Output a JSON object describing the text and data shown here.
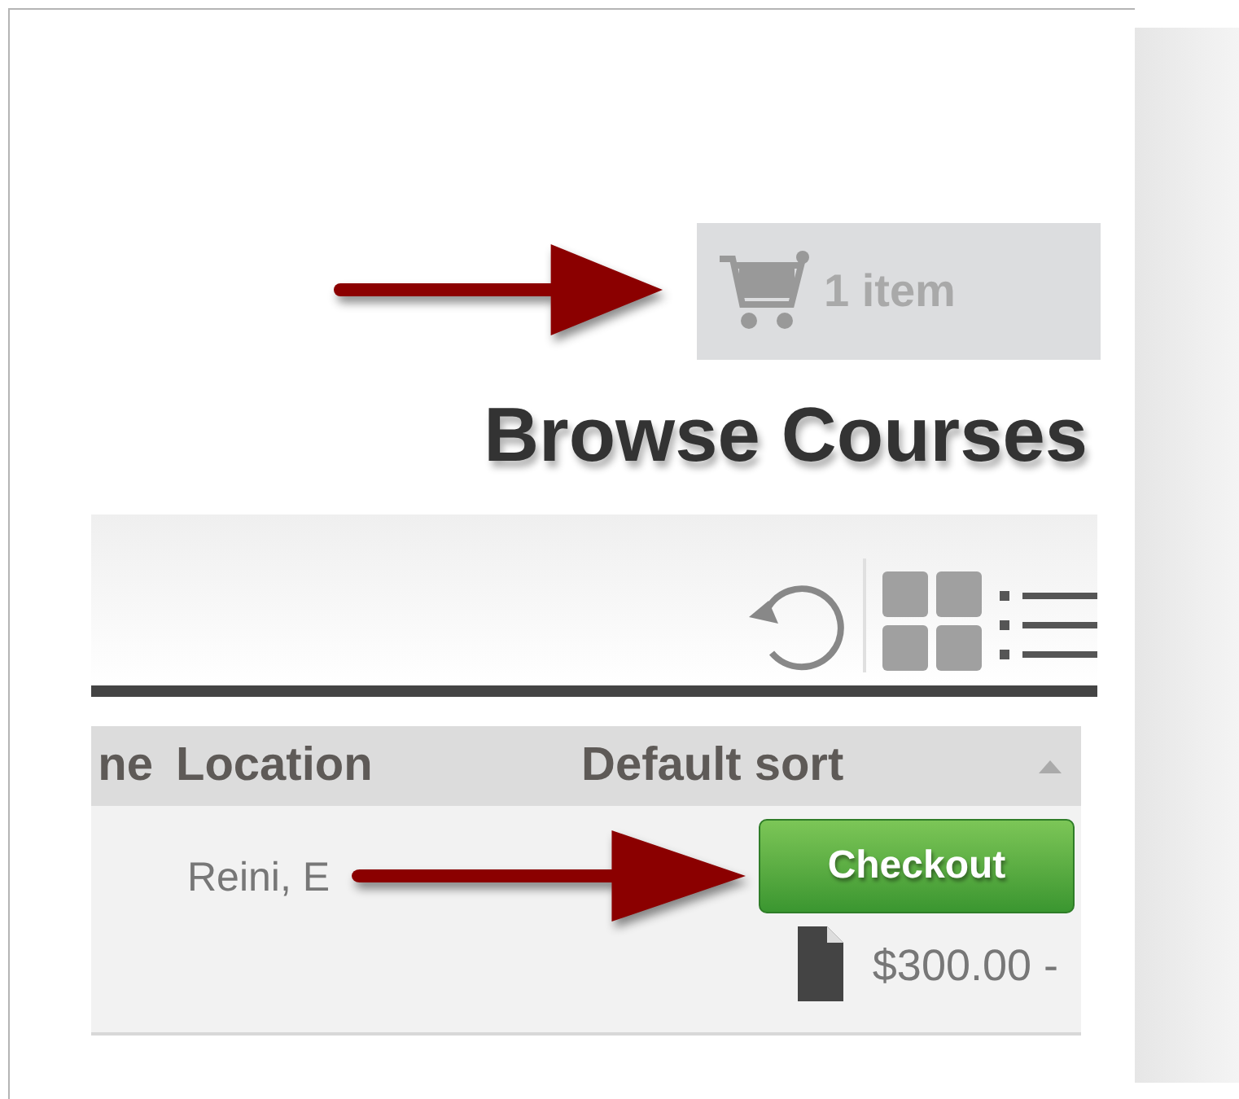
{
  "cart": {
    "label": "1 item"
  },
  "heading": "Browse Courses",
  "table": {
    "columns": [
      {
        "label": "ne"
      },
      {
        "label": "Location"
      },
      {
        "label": "Default sort"
      }
    ],
    "sorted_ascending": true,
    "rows": [
      {
        "location": "Reini, E",
        "action": "Checkout",
        "price": "$300.00 -"
      }
    ]
  }
}
